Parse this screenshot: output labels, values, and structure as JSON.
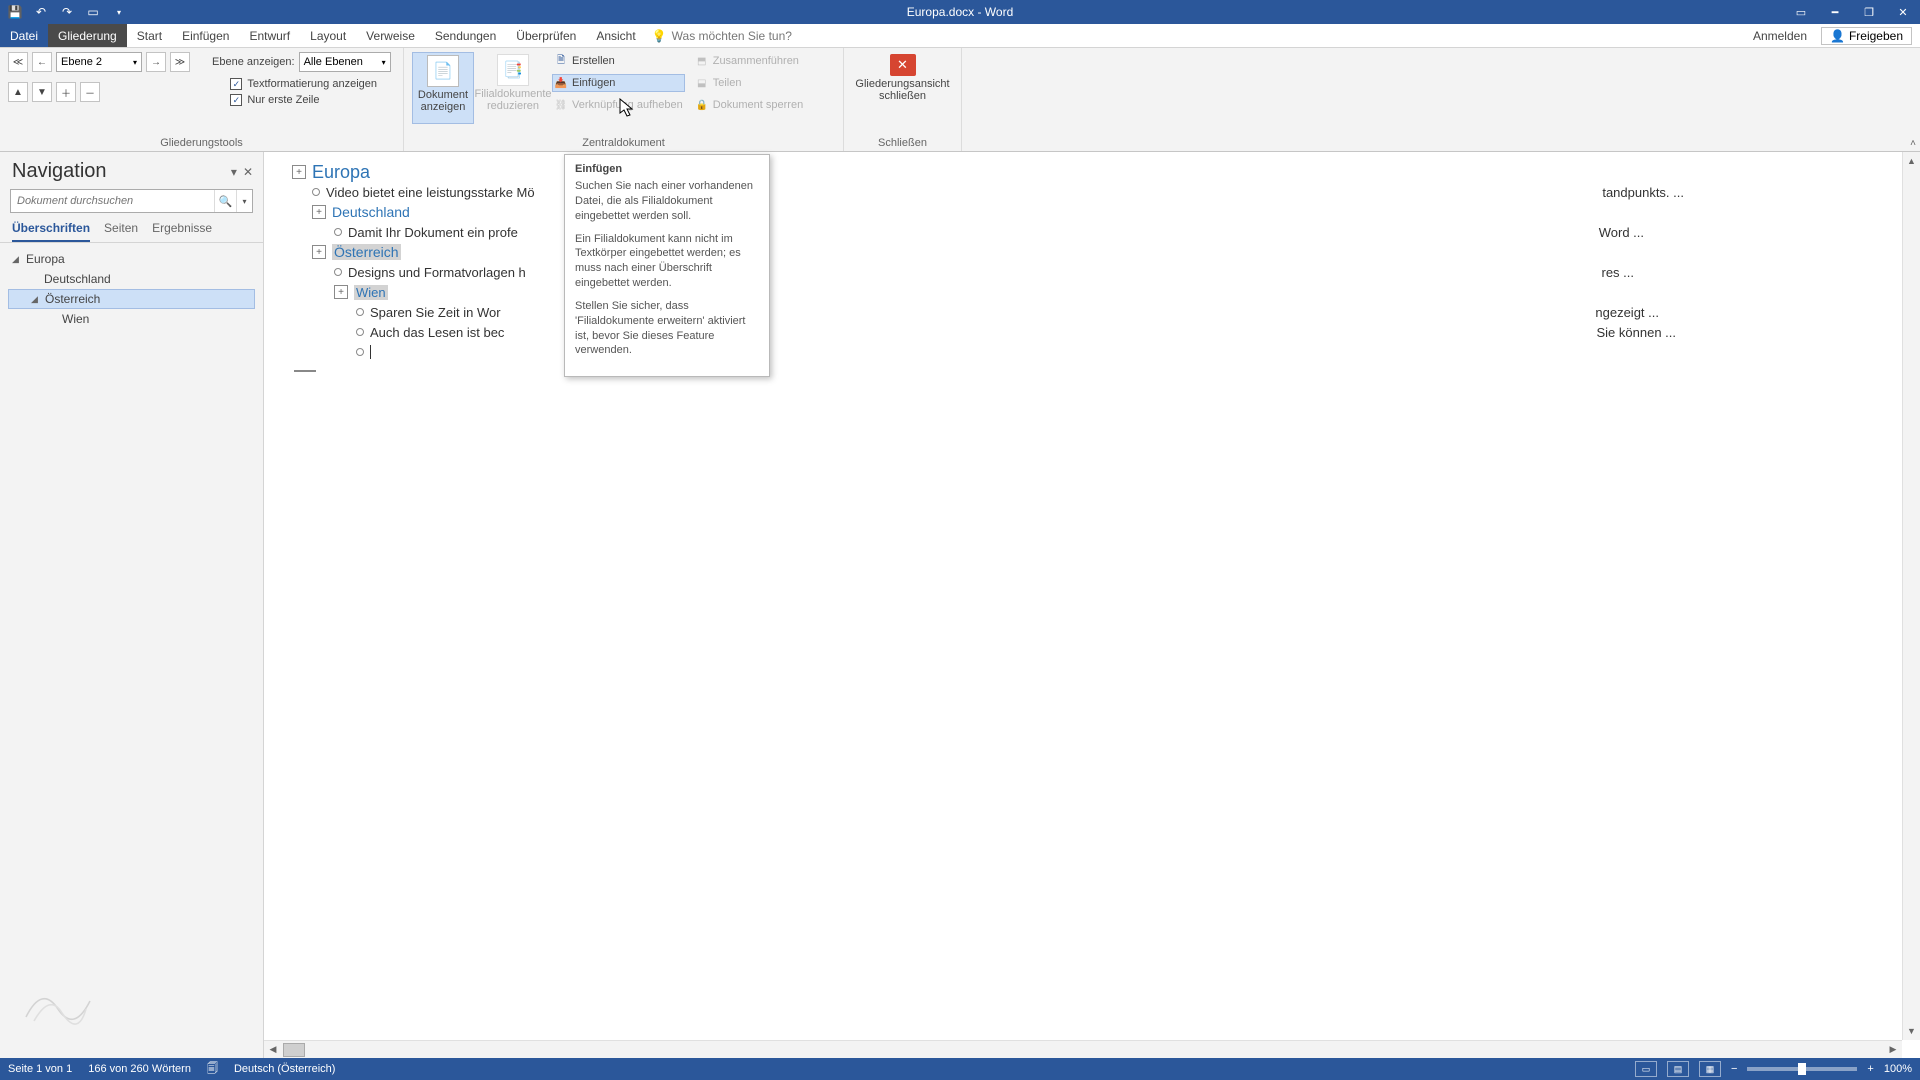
{
  "title": "Europa.docx - Word",
  "qat": {
    "level": "Ebene 2"
  },
  "tabs": {
    "file": "Datei",
    "context": "Gliederung",
    "list": [
      "Start",
      "Einfügen",
      "Entwurf",
      "Layout",
      "Verweise",
      "Sendungen",
      "Überprüfen",
      "Ansicht"
    ],
    "tellme": "Was möchten Sie tun?",
    "signin": "Anmelden",
    "share": "Freigeben"
  },
  "ribbon": {
    "group_tools": "Gliederungstools",
    "level_label": "Ebene anzeigen:",
    "level_value": "Alle Ebenen",
    "chk_format": "Textformatierung anzeigen",
    "chk_firstline": "Nur erste Zeile",
    "bigbtn_show": "Dokument anzeigen",
    "bigbtn_reduce": "Filialdokumente reduzieren",
    "cmd_create": "Erstellen",
    "cmd_insert": "Einfügen",
    "cmd_unlink": "Verknüpfung aufheben",
    "cmd_merge": "Zusammenführen",
    "cmd_split": "Teilen",
    "cmd_lock": "Dokument sperren",
    "group_master": "Zentraldokument",
    "close_view": "Gliederungsansicht schließen",
    "group_close": "Schließen"
  },
  "nav": {
    "title": "Navigation",
    "search_placeholder": "Dokument durchsuchen",
    "tabs": [
      "Überschriften",
      "Seiten",
      "Ergebnisse"
    ],
    "tree": {
      "root": "Europa",
      "c1": "Deutschland",
      "c2": "Österreich",
      "c3": "Wien"
    }
  },
  "outline": {
    "h1": "Europa",
    "b1": "Video bietet eine leistungsstarke Mö",
    "b1_tail": "tandpunkts. ...",
    "h2a": "Deutschland",
    "b2": "Damit Ihr Dokument ein profe",
    "b2_tail": "Word ...",
    "h2b": "Österreich",
    "b3": "Designs und Formatvorlagen h",
    "b3_tail": "res ...",
    "h3": "Wien",
    "b4": "Sparen Sie Zeit in Wor",
    "b4_tail": "ngezeigt ...",
    "b5": "Auch das Lesen ist bec",
    "b5_tail": "Sie können ..."
  },
  "tooltip": {
    "title": "Einfügen",
    "p1": "Suchen Sie nach einer vorhandenen Datei, die als Filialdokument eingebettet werden soll.",
    "p2": "Ein Filialdokument kann nicht im Textkörper eingebettet werden; es muss nach einer Überschrift eingebettet werden.",
    "p3": "Stellen Sie sicher, dass 'Filialdokumente erweitern' aktiviert ist, bevor Sie dieses Feature verwenden."
  },
  "status": {
    "page": "Seite 1 von 1",
    "words": "166 von 260 Wörtern",
    "lang": "Deutsch (Österreich)",
    "zoom": "100%"
  }
}
